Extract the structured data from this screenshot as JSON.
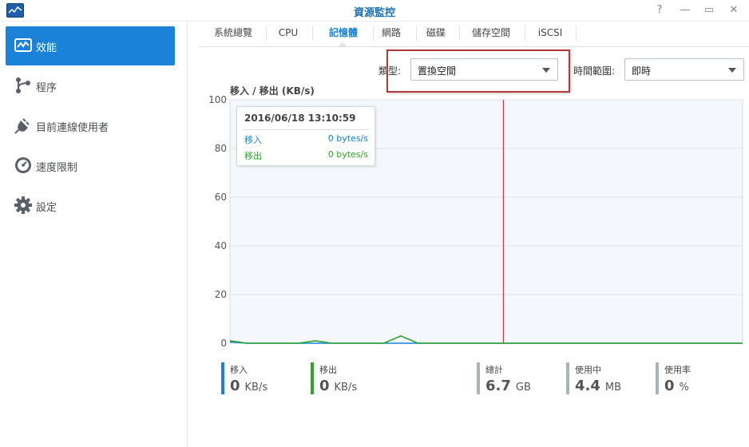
{
  "window": {
    "title": "資源監控",
    "icon": "performance-chart-icon",
    "controls": [
      {
        "name": "help-button",
        "glyph": "?"
      },
      {
        "name": "minimize-button",
        "glyph": "—"
      },
      {
        "name": "maximize-button",
        "glyph": "▭"
      },
      {
        "name": "close-button",
        "glyph": "✕"
      }
    ]
  },
  "sidebar": {
    "items": [
      {
        "label": "效能",
        "icon": "performance-icon",
        "active": true
      },
      {
        "label": "程序",
        "icon": "process-icon",
        "active": false
      },
      {
        "label": "目前連線使用者",
        "icon": "plug-icon",
        "active": false
      },
      {
        "label": "速度限制",
        "icon": "speed-limit-icon",
        "active": false
      },
      {
        "label": "設定",
        "icon": "gear-icon",
        "active": false
      }
    ]
  },
  "tabs": [
    {
      "label": "系統總覽",
      "active": false
    },
    {
      "label": "CPU",
      "active": false
    },
    {
      "label": "記憶體",
      "active": true
    },
    {
      "label": "網路",
      "active": false
    },
    {
      "label": "磁碟",
      "active": false
    },
    {
      "label": "儲存空間",
      "active": false
    },
    {
      "label": "iSCSI",
      "active": false
    }
  ],
  "filters": {
    "type_label": "類型:",
    "type_value": "置換空間",
    "range_label": "時間範圍:",
    "range_value": "即時"
  },
  "tooltip": {
    "time": "2016/06/18 13:10:59",
    "in_label": "移入",
    "in_value": "0 bytes/s",
    "out_label": "移出",
    "out_value": "0 bytes/s"
  },
  "chart_data": {
    "type": "line",
    "title": "移入 / 移出 (KB/s)",
    "ylim": [
      0,
      100
    ],
    "yticks": [
      0,
      20,
      40,
      60,
      80,
      100
    ],
    "grid": true,
    "x": [
      0,
      1,
      2,
      3,
      4,
      5,
      6,
      7,
      8,
      9,
      10,
      11,
      12,
      13,
      14,
      15,
      16,
      17,
      18,
      19,
      20,
      21,
      22,
      23,
      24,
      25,
      26,
      27,
      28,
      29,
      30
    ],
    "series": [
      {
        "name": "移入",
        "color": "#1a82d8",
        "values": [
          0.5,
          0,
          0,
          0,
          0,
          0,
          0,
          0,
          0,
          0,
          0,
          0,
          0,
          0,
          0,
          0,
          0,
          0,
          0,
          0,
          0,
          0,
          0,
          0,
          0,
          0,
          0,
          0,
          0,
          0,
          0
        ]
      },
      {
        "name": "移出",
        "color": "#2ea32e",
        "values": [
          1,
          0,
          0,
          0,
          0,
          1,
          0,
          0,
          0,
          0,
          3,
          0,
          0,
          0,
          0,
          0,
          0,
          0,
          0,
          0,
          0,
          0,
          0,
          0,
          0,
          0,
          0,
          0,
          0,
          0,
          0
        ]
      }
    ],
    "cursor_x": 16
  },
  "stats": [
    {
      "label": "移入",
      "value": "0",
      "unit": "KB/s",
      "color": "#1a82d8"
    },
    {
      "label": "移出",
      "value": "0",
      "unit": "KB/s",
      "color": "#2ea32e"
    },
    {
      "label": "總計",
      "value": "6.7",
      "unit": "GB",
      "color": "#a9b3be"
    },
    {
      "label": "使用中",
      "value": "4.4",
      "unit": "MB",
      "color": "#a9b3be"
    },
    {
      "label": "使用率",
      "value": "0",
      "unit": "%",
      "color": "#a9b3be"
    }
  ],
  "colors": {
    "accent": "#1a82d8",
    "out_series": "#2ea32e",
    "cursor_line": "#e03a3a",
    "highlight_border": "#b33a3a",
    "plot_bg": "#f4f8fc"
  }
}
